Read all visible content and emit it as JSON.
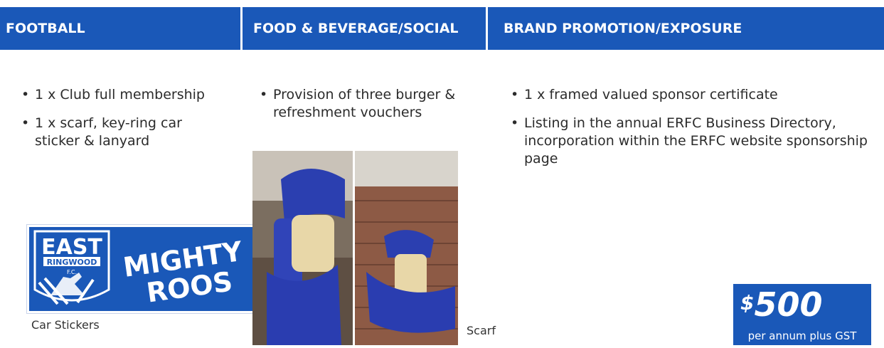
{
  "headers": {
    "football": "FOOTBALL",
    "food": "FOOD & BEVERAGE/SOCIAL",
    "brand": "BRAND PROMOTION/EXPOSURE"
  },
  "football_items": [
    "1 x Club full membership",
    "1 x scarf, key-ring car sticker & lanyard"
  ],
  "food_items": [
    "Provision of three burger & refreshment vouchers"
  ],
  "brand_items": [
    "1 x framed valued sponsor certificate",
    "Listing in the annual ERFC Business Directory, incorporation within the ERFC website sponsorship page"
  ],
  "sticker": {
    "logo_top": "EAST",
    "logo_band": "RINGWOOD",
    "logo_fc": "F.C.",
    "slogan_1": "MIGHTY",
    "slogan_2": "ROOS"
  },
  "captions": {
    "stickers": "Car Stickers",
    "scarf": "Scarf"
  },
  "price": {
    "symbol": "$",
    "amount": "500",
    "note": "per annum plus GST"
  },
  "colors": {
    "brand_blue": "#1a58b8",
    "text": "#2b2b2b",
    "white": "#ffffff"
  }
}
